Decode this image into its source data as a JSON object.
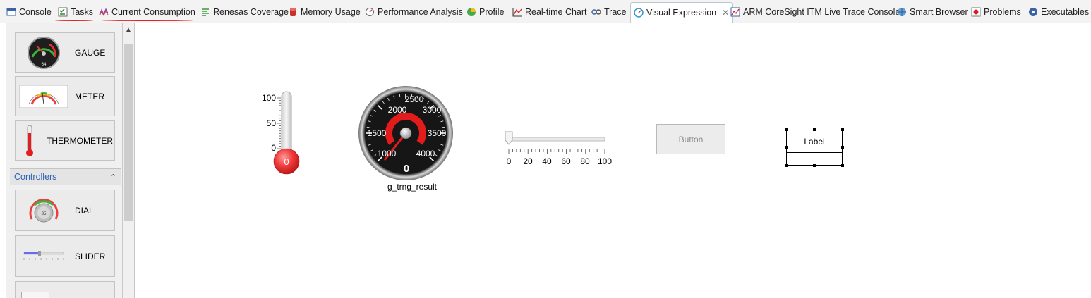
{
  "tabs": [
    {
      "label": "Console",
      "icon": "console-icon"
    },
    {
      "label": "Tasks",
      "icon": "tasks-icon"
    },
    {
      "label": "Current Consumption",
      "icon": "current-consumption-icon"
    },
    {
      "label": "Renesas Coverage",
      "icon": "coverage-icon"
    },
    {
      "label": "Memory Usage",
      "icon": "memory-usage-icon"
    },
    {
      "label": "Performance Analysis",
      "icon": "performance-icon"
    },
    {
      "label": "Profile",
      "icon": "profile-icon"
    },
    {
      "label": "Real-time Chart",
      "icon": "realtime-chart-icon"
    },
    {
      "label": "Trace",
      "icon": "trace-icon"
    },
    {
      "label": "Visual Expression",
      "icon": "visual-expression-icon",
      "active": true
    },
    {
      "label": "ARM CoreSight ITM Live Trace Console",
      "icon": "itm-console-icon"
    },
    {
      "label": "Smart Browser",
      "icon": "smart-browser-icon"
    },
    {
      "label": "Problems",
      "icon": "problems-icon"
    },
    {
      "label": "Executables",
      "icon": "executables-icon"
    }
  ],
  "palette": {
    "indicators": [
      {
        "label": "GAUGE",
        "thumb_text": "64"
      },
      {
        "label": "METER"
      },
      {
        "label": "THERMOMETER"
      }
    ],
    "controllers_header": "Controllers",
    "controllers": [
      {
        "label": "DIAL",
        "thumb_text": "35"
      },
      {
        "label": "SLIDER"
      }
    ]
  },
  "canvas": {
    "thermometer": {
      "ticks": [
        "100",
        "50",
        "0"
      ],
      "value": "0",
      "level": 0
    },
    "gauge": {
      "ticks": [
        "1000",
        "1500",
        "2000",
        "2500",
        "3000",
        "3500",
        "4000"
      ],
      "value": "0",
      "caption": "g_trng_result"
    },
    "slider": {
      "ticks": [
        "0",
        "20",
        "40",
        "60",
        "80",
        "100"
      ],
      "value": 0
    },
    "button": {
      "label": "Button"
    },
    "label_widget": {
      "text": "Label"
    }
  },
  "colors": {
    "accent_red": "#e0201d",
    "link_blue": "#2d63b8"
  }
}
